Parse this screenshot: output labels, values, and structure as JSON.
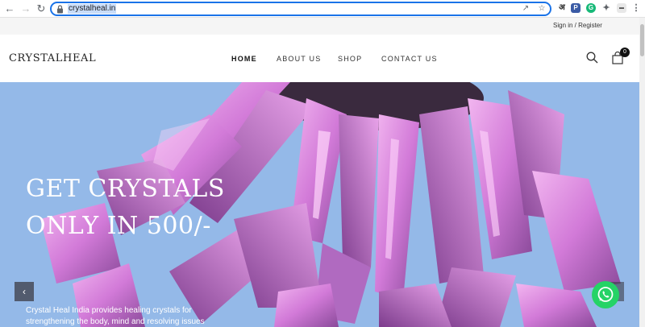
{
  "browser": {
    "url": "crystalheal.in"
  },
  "topbar": {
    "signin": "Sign in / Register"
  },
  "header": {
    "logo": "CRYSTALHEAL",
    "menu": [
      "HOME",
      "ABOUT US",
      "SHOP",
      "CONTACT US"
    ],
    "cart_count": "0"
  },
  "hero": {
    "headline_line1": "GET CRYSTALS",
    "headline_line2": "ONLY IN 500/-",
    "description_line1": "Crystal Heal India provides healing crystals for",
    "description_line2": "strengthening the body, mind and resolving issues",
    "prev_arrow": "‹"
  },
  "colors": {
    "hero_bg": "#94b9e8",
    "crystal": "#d98ae0",
    "whatsapp": "#25d366",
    "address_focus": "#1a73e8"
  },
  "icons": [
    "back-icon",
    "forward-icon",
    "reload-icon",
    "lock-icon",
    "share-icon",
    "star-icon",
    "extensions-icon",
    "more-icon",
    "search-icon",
    "cart-icon",
    "whatsapp-icon",
    "chevron-left-icon"
  ]
}
